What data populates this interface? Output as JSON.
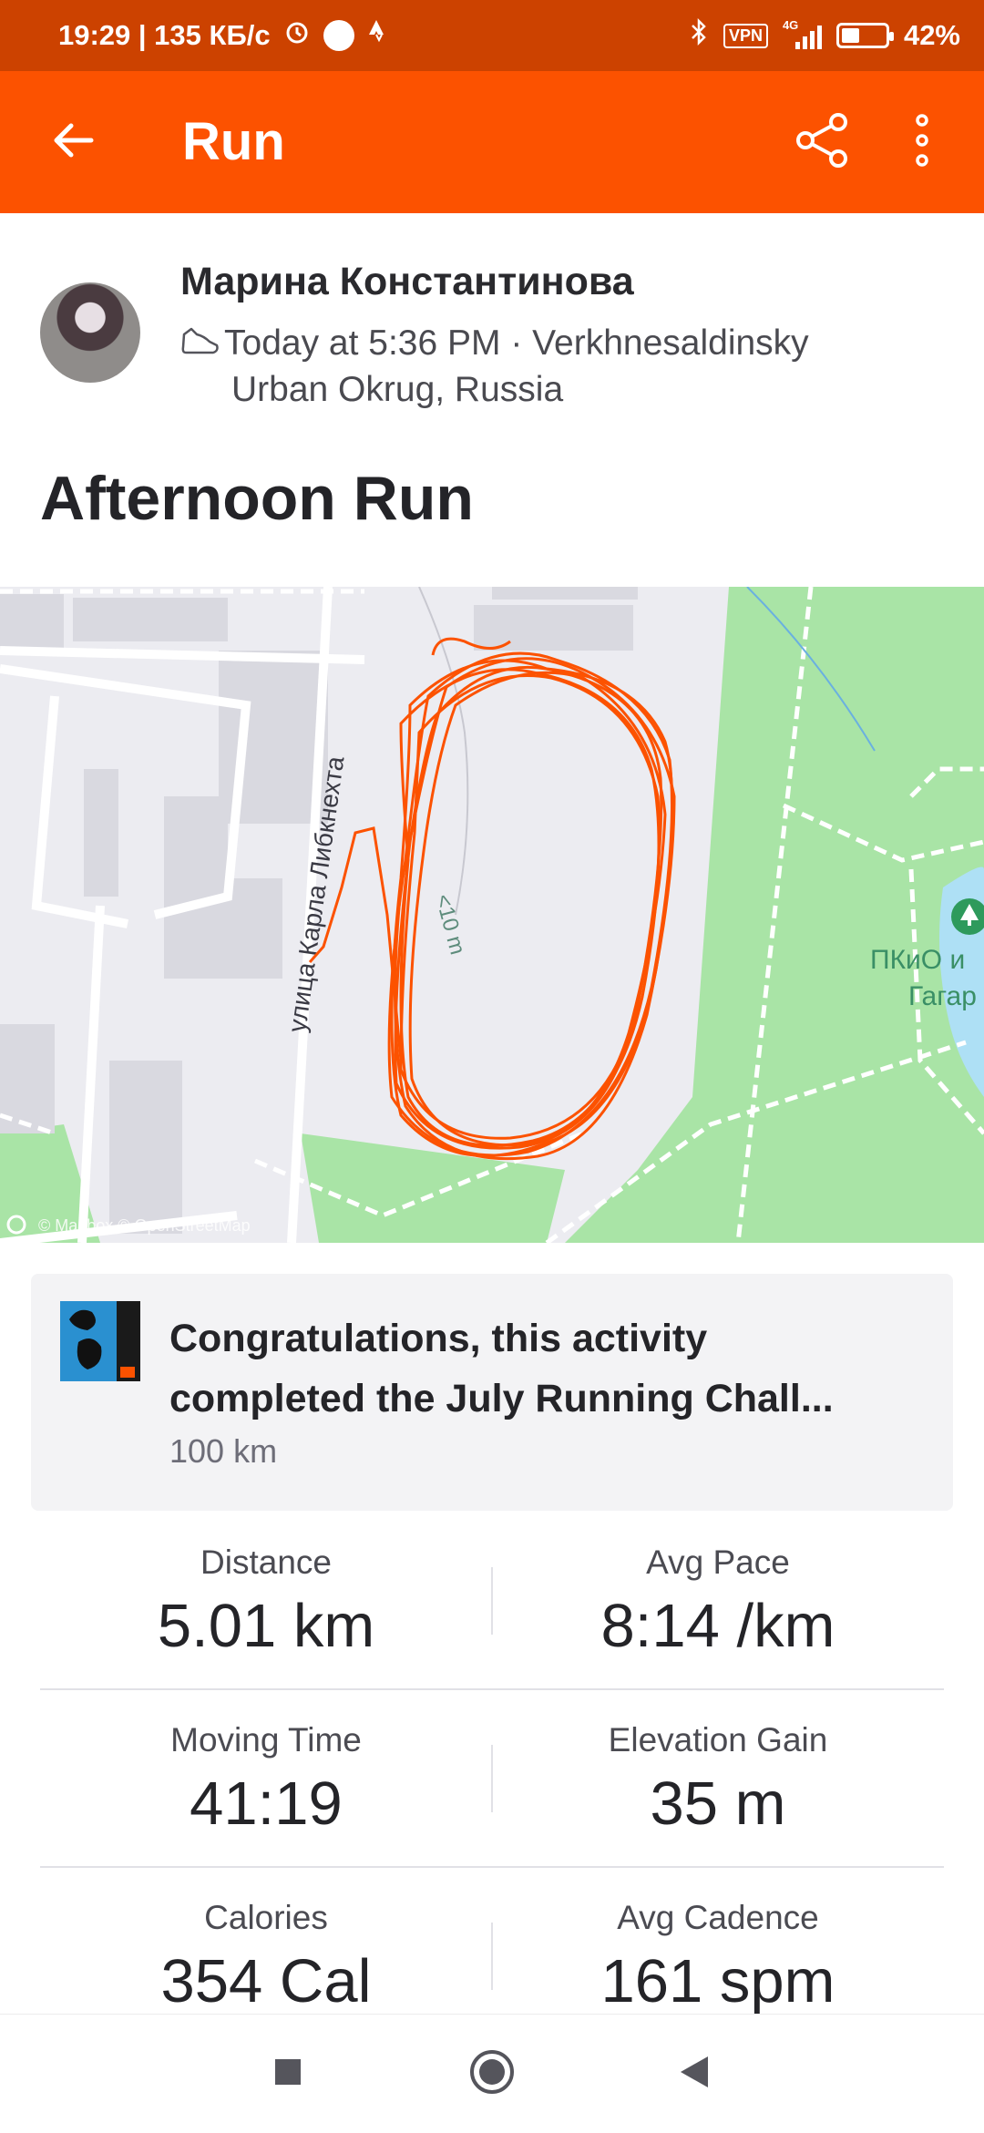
{
  "status_bar": {
    "time_speed": "19:29 | 135 КБ/с",
    "vpn": "VPN",
    "network": "4G",
    "battery": "42%",
    "battery_level": 0.42
  },
  "app_bar": {
    "title": "Run",
    "icons": [
      "back-arrow-icon",
      "share-icon",
      "more-vertical-icon"
    ]
  },
  "athlete": {
    "name": "Марина Константинова",
    "time_location_line1": "Today at 5:36 PM · Verkhnesaldinsky",
    "time_location_line2": "Urban Okrug, Russia"
  },
  "activity": {
    "title": "Afternoon Run"
  },
  "map": {
    "street_label": "улица Карла Либкнехта",
    "track_label": "<10 m",
    "park_label_line1": "ПКиО и",
    "park_label_line2": "Гагар",
    "attribution": "© Mapbox © OpenStreetMap",
    "route_color": "#fc5200",
    "park_color": "#a9e4a6"
  },
  "challenge": {
    "title_line1": "Congratulations, this activity",
    "title_line2": "completed the July Running Chall...",
    "subtitle": "100 km"
  },
  "stats": [
    {
      "label": "Distance",
      "value": "5.01 km"
    },
    {
      "label": "Avg Pace",
      "value": "8:14 /km"
    },
    {
      "label": "Moving Time",
      "value": "41:19"
    },
    {
      "label": "Elevation Gain",
      "value": "35 m"
    },
    {
      "label": "Calories",
      "value": "354 Cal"
    },
    {
      "label": "Avg Cadence",
      "value": "161 spm"
    }
  ],
  "nav_bar": {
    "icons": [
      "recents-square-icon",
      "home-circle-icon",
      "back-triangle-icon"
    ]
  },
  "colors": {
    "status_bar": "#cc4200",
    "brand_orange": "#fc5200",
    "text": "#242428"
  }
}
